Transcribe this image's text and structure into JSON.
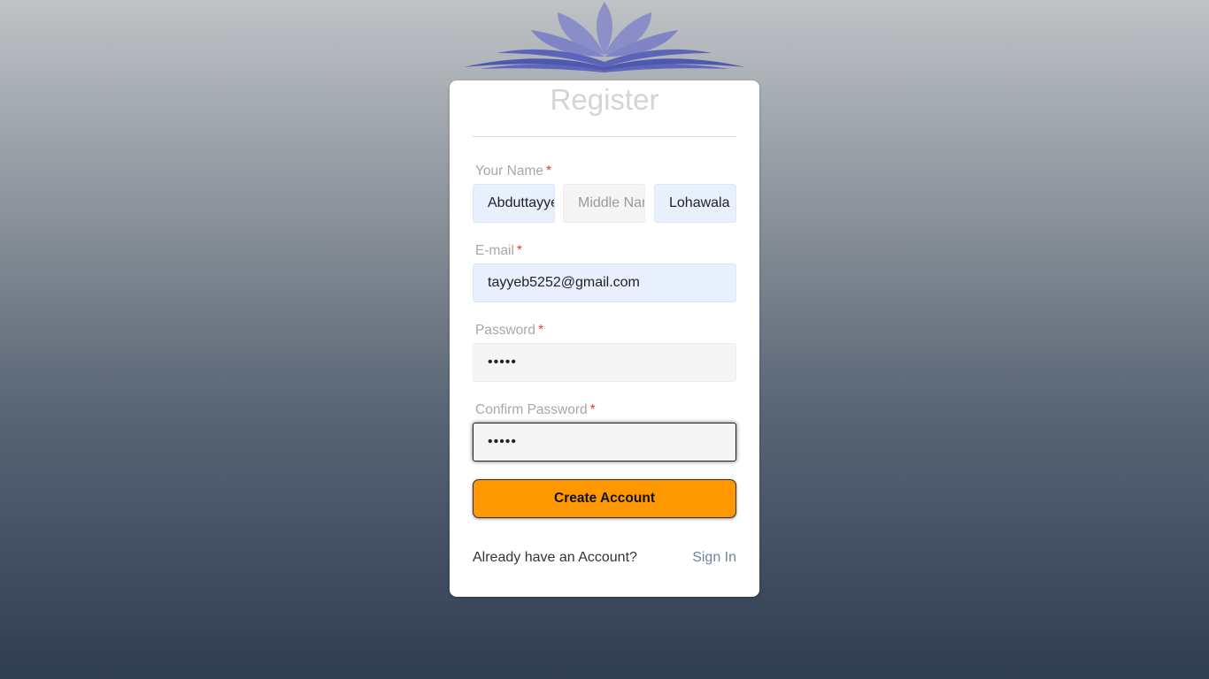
{
  "logo": {
    "icon": "open-book-lotus-logo",
    "color": "#5a62b5"
  },
  "form": {
    "title": "Register",
    "name_label": "Your Name",
    "first_name_value": "Abduttayyeb",
    "middle_name_placeholder": "Middle Name",
    "last_name_value": "Lohawala",
    "email_label": "E-mail",
    "email_value": "tayyeb5252@gmail.com",
    "password_label": "Password",
    "password_mask": "•••••",
    "confirm_password_label": "Confirm Password",
    "confirm_password_mask": "•••••",
    "required_marker": "*",
    "create_button": "Create Account"
  },
  "footer": {
    "prompt": "Already have an Account?",
    "signin_link": "Sign In"
  },
  "colors": {
    "accent_button": "#ff9800",
    "required": "#e53935",
    "link": "#6b849a",
    "autofill_bg": "#e8f0fe"
  }
}
